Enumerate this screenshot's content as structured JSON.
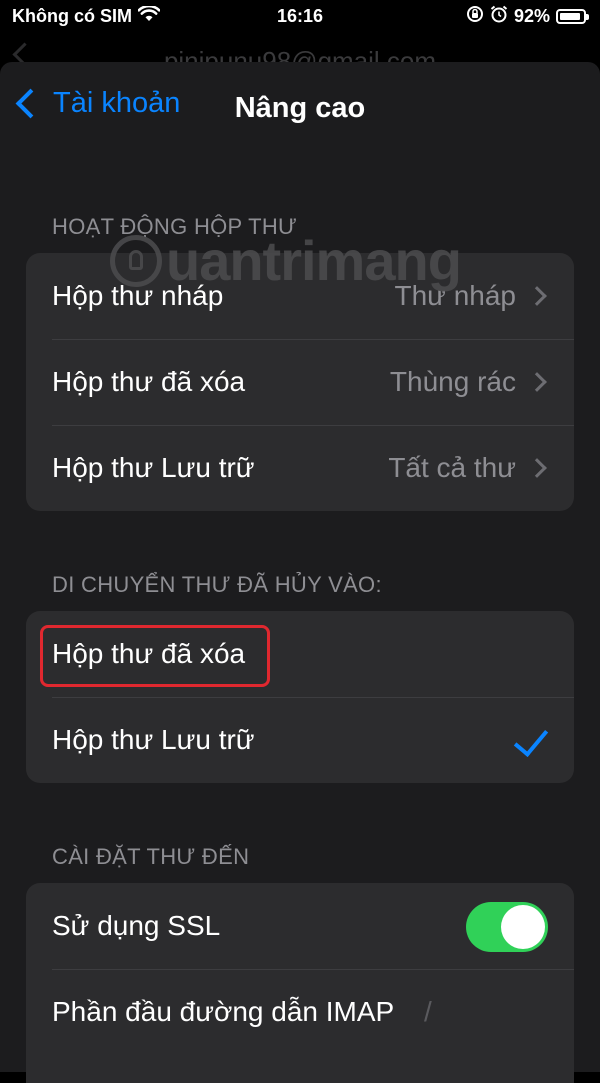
{
  "status_bar": {
    "carrier": "Không có SIM",
    "time": "16:16",
    "battery": "92%",
    "battery_level": 0.92
  },
  "behind": {
    "title": "pinipunu98@gmail.com"
  },
  "nav": {
    "back_label": "Tài khoản",
    "title": "Nâng cao"
  },
  "mailbox_behaviors": {
    "header": "HOẠT ĐỘNG HỘP THƯ",
    "rows": [
      {
        "label": "Hộp thư nháp",
        "value": "Thư nháp"
      },
      {
        "label": "Hộp thư đã xóa",
        "value": "Thùng rác"
      },
      {
        "label": "Hộp thư Lưu trữ",
        "value": "Tất cả thư"
      }
    ]
  },
  "move_discarded": {
    "header": "DI CHUYỂN THƯ ĐÃ HỦY VÀO:",
    "options": [
      {
        "label": "Hộp thư đã xóa",
        "selected": false
      },
      {
        "label": "Hộp thư Lưu trữ",
        "selected": true
      }
    ]
  },
  "incoming": {
    "header": "CÀI ĐẶT THƯ ĐẾN",
    "ssl_label": "Sử dụng SSL",
    "ssl_on": true,
    "imap_label": "Phần đầu đường dẫn IMAP",
    "imap_value": "/"
  },
  "watermark": "uantrimang",
  "colors": {
    "accent": "#0a84ff",
    "toggle_on": "#30d158",
    "highlight": "#e0282f"
  }
}
